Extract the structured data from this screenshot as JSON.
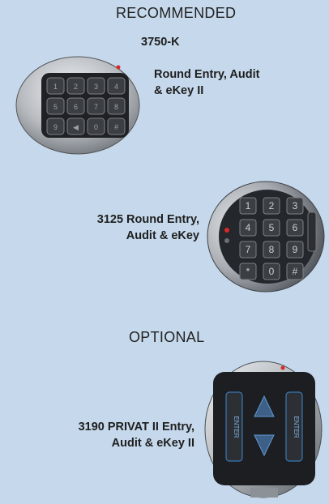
{
  "sections": {
    "recommended": "RECOMMENDED",
    "optional": "OPTIONAL"
  },
  "products": [
    {
      "model": "3750-K",
      "desc_line1": "Round Entry, Audit",
      "desc_line2": "& eKey II",
      "keys": [
        "1",
        "2",
        "3",
        "4",
        "5",
        "6",
        "7",
        "8",
        "9",
        "◀",
        "0",
        "#"
      ]
    },
    {
      "model_line1": "3125 Round Entry,",
      "model_line2": "Audit & eKey",
      "keys": [
        "1",
        "2",
        "3",
        "4",
        "5",
        "6",
        "7",
        "8",
        "9",
        "*",
        "0",
        "#"
      ]
    },
    {
      "model_line1": "3190 PRIVAT II Entry,",
      "model_line2": "Audit & eKey II",
      "left_key": "ENTER",
      "right_key": "ENTER"
    }
  ],
  "colors": {
    "background": "#c6d9ec",
    "bezel": "#b8bcc2",
    "keypad_face": "#1f2124",
    "key": "#3b3e43",
    "indicator_red": "#d8282a"
  }
}
